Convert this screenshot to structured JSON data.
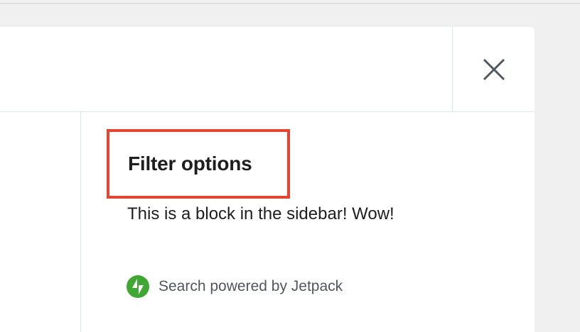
{
  "modal": {
    "close_icon": "close-icon"
  },
  "sidebar": {
    "title": "Filter options",
    "block_text": "This is a block in the sidebar! Wow!",
    "powered_by": {
      "icon": "jetpack-icon",
      "label": "Search powered by Jetpack"
    }
  },
  "colors": {
    "highlight": "#e54530",
    "jetpack_green": "#3fa833",
    "divider": "#d6ecec",
    "text": "#1e1e1e",
    "muted_text": "#50575e"
  }
}
